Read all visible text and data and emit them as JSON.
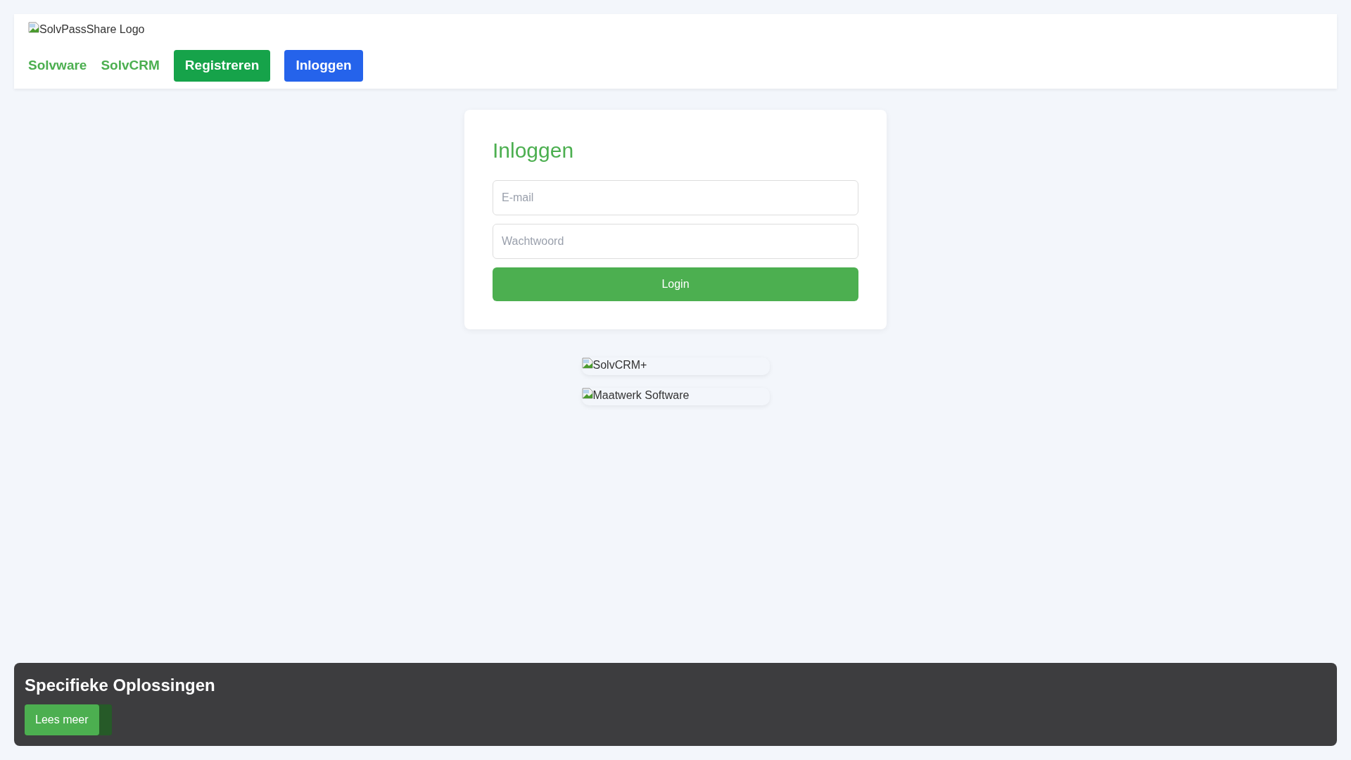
{
  "header": {
    "logo_alt": "SolvPassShare Logo",
    "nav": [
      {
        "label": "Solvware",
        "kind": "link"
      },
      {
        "label": "SolvCRM",
        "kind": "link"
      },
      {
        "label": "Registreren",
        "kind": "green"
      },
      {
        "label": "Inloggen",
        "kind": "blue"
      }
    ]
  },
  "login": {
    "title": "Inloggen",
    "email": {
      "placeholder": "E-mail"
    },
    "password": {
      "placeholder": "Wachtwoord"
    },
    "button": "Login"
  },
  "images": [
    {
      "alt": "SolvCRM+"
    },
    {
      "alt": "Maatwerk Software"
    }
  ],
  "banner": {
    "title": "Specifieke Oplossingen",
    "button": "Lees meer"
  }
}
